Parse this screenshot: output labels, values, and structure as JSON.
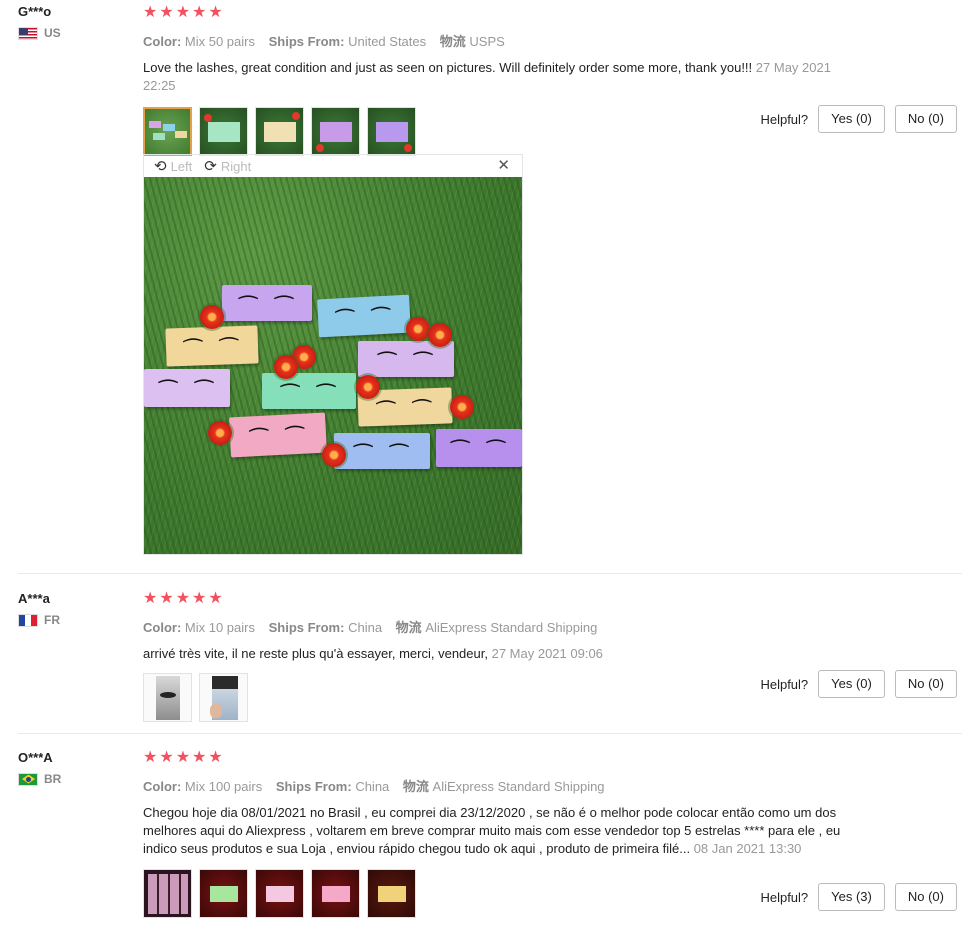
{
  "helpful_label": "Helpful?",
  "labels": {
    "color": "Color:",
    "ships_from": "Ships From:",
    "logistics": "物流"
  },
  "viewer": {
    "left_label": "Left",
    "right_label": "Right",
    "close_glyph": "✕"
  },
  "star_glyph": "★",
  "colors": {
    "star": "#f2525f",
    "active_thumb_border": "#e5a048"
  },
  "reviews": [
    {
      "name": "G***o",
      "country": "US",
      "rating": 5,
      "color": "Mix 50 pairs",
      "ships_from": "United States",
      "logistics": "USPS",
      "text": "Love the lashes, great condition and just as seen on pictures. Will definitely order some more, thank you!!!",
      "date": "27 May 2021 22:25",
      "yes_label": "Yes (0)",
      "no_label": "No (0)",
      "photos": 5
    },
    {
      "name": "A***a",
      "country": "FR",
      "rating": 5,
      "color": "Mix 10 pairs",
      "ships_from": "China",
      "logistics": "AliExpress Standard Shipping",
      "text": "arrivé très vite, il ne reste plus qu'à essayer, merci, vendeur,",
      "date": "27 May 2021 09:06",
      "yes_label": "Yes (0)",
      "no_label": "No (0)",
      "photos": 2
    },
    {
      "name": "O***A",
      "country": "BR",
      "rating": 5,
      "color": "Mix 100 pairs",
      "ships_from": "China",
      "logistics": "AliExpress Standard Shipping",
      "text": "Chegou hoje dia 08/01/2021 no Brasil , eu comprei dia 23/12/2020 , se não é o melhor pode colocar então como um dos melhores aqui do Aliexpress , voltarem em breve comprar muito mais com esse vendedor top 5 estrelas **** para ele , eu indico seus produtos e sua Loja , enviou rápido chegou tudo ok aqui , produto de primeira filé...",
      "date": "08 Jan 2021 13:30",
      "yes_label": "Yes (3)",
      "no_label": "No (0)",
      "photos": 5
    }
  ]
}
